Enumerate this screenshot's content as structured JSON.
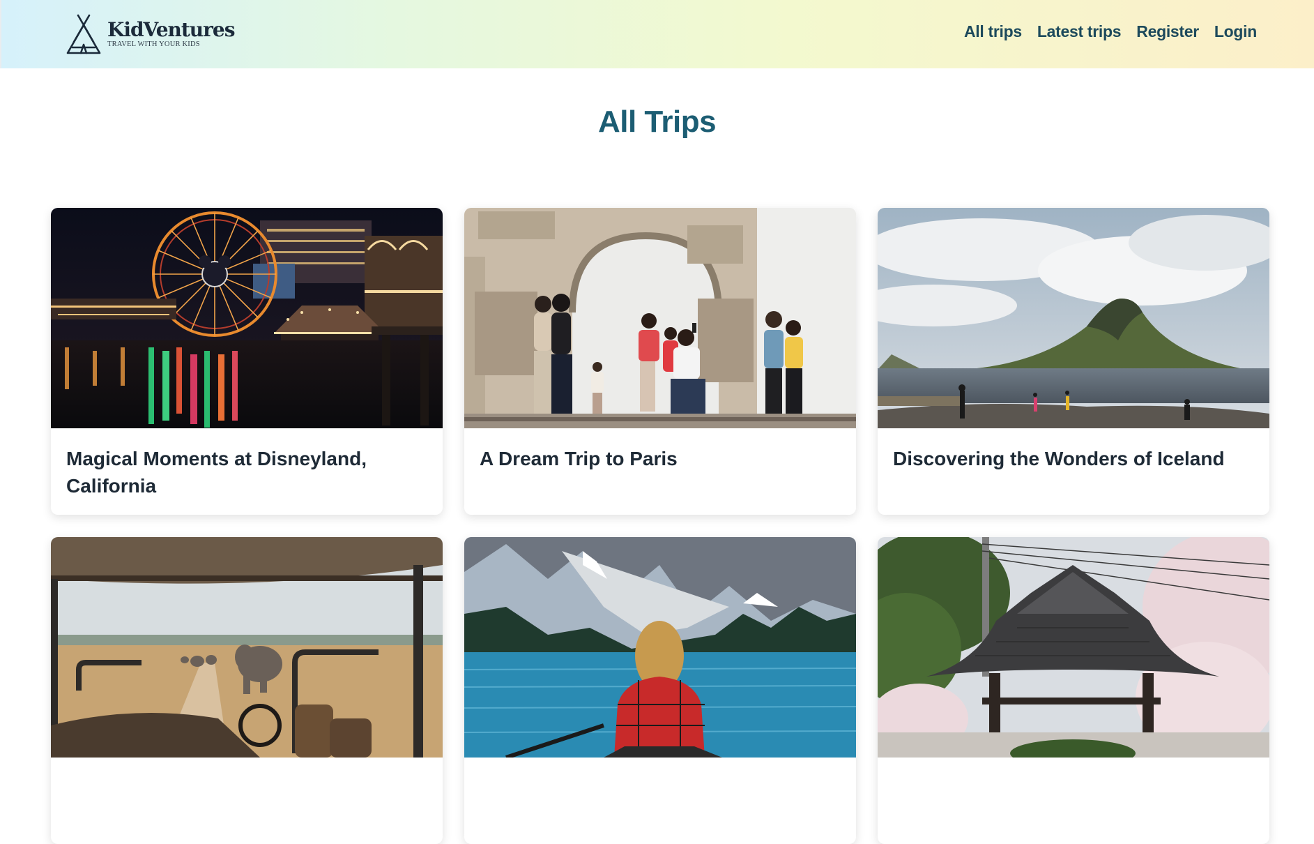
{
  "brand": {
    "name": "KidVentures",
    "tagline": "TRAVEL WITH YOUR KIDS"
  },
  "nav": {
    "items": [
      {
        "label": "All trips"
      },
      {
        "label": "Latest trips"
      },
      {
        "label": "Register"
      },
      {
        "label": "Login"
      }
    ]
  },
  "page": {
    "title": "All Trips"
  },
  "trips": [
    {
      "title": "Magical Moments at Disneyland, California"
    },
    {
      "title": "A Dream Trip to Paris"
    },
    {
      "title": "Discovering the Wonders of Iceland"
    },
    {
      "title": ""
    },
    {
      "title": ""
    },
    {
      "title": ""
    }
  ],
  "colors": {
    "title": "#1c5d73",
    "nav": "#1d4a5c",
    "card_title": "#1e2a36"
  }
}
